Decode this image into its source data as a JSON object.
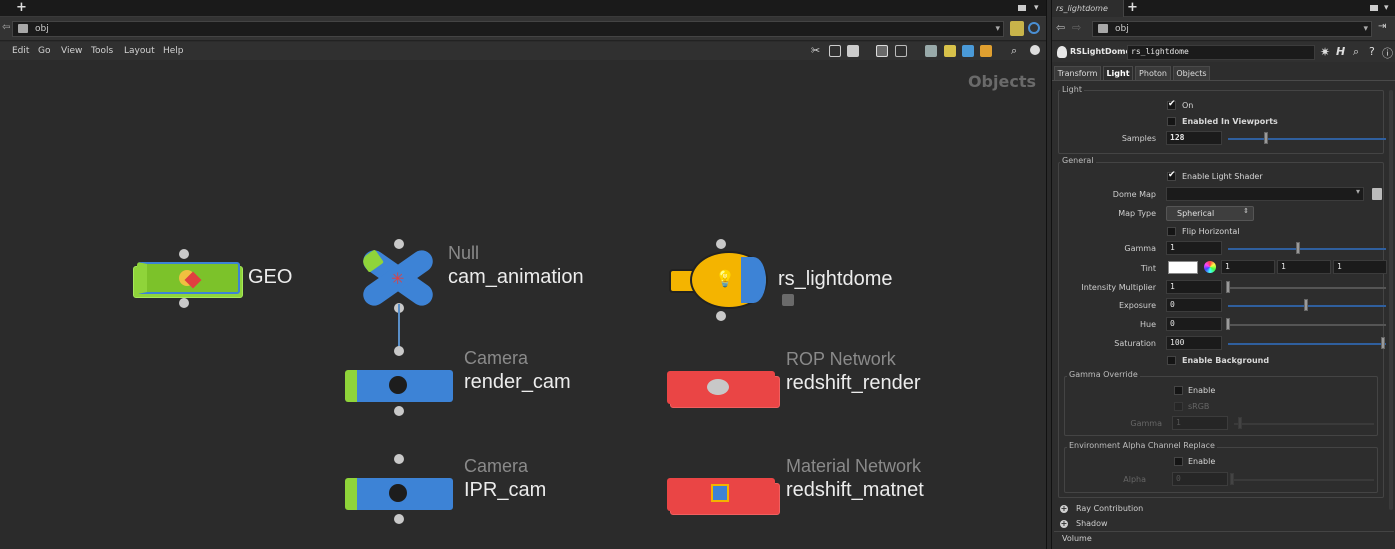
{
  "left_pane": {
    "path": "obj",
    "menu": [
      "Edit",
      "Go",
      "View",
      "Tools",
      "Layout",
      "Help"
    ],
    "network_title": "Objects"
  },
  "nodes": {
    "geo": {
      "name": "GEO",
      "type": ""
    },
    "null": {
      "name": "cam_animation",
      "type": "Null"
    },
    "light": {
      "name": "rs_lightdome",
      "type": ""
    },
    "render_cam": {
      "name": "render_cam",
      "type": "Camera"
    },
    "rop": {
      "name": "redshift_render",
      "type": "ROP Network"
    },
    "ipr_cam": {
      "name": "IPR_cam",
      "type": "Camera"
    },
    "matnet": {
      "name": "redshift_matnet",
      "type": "Material Network"
    }
  },
  "right_pane": {
    "tab_title": "rs_lightdome",
    "path": "obj",
    "node_type": "RSLightDome",
    "node_name": "rs_lightdome",
    "tabs": [
      "Transform",
      "Light",
      "Photon",
      "Objects"
    ],
    "active_tab": "Light",
    "light_group": {
      "title": "Light",
      "on_label": "On",
      "on_checked": true,
      "viewports_label": "Enabled In Viewports",
      "viewports_checked": false,
      "samples_label": "Samples",
      "samples_value": "128",
      "samples_fraction": 0.25
    },
    "general_group": {
      "title": "General",
      "enable_shader_label": "Enable Light Shader",
      "enable_shader_checked": true,
      "dome_map_label": "Dome Map",
      "dome_map_value": "",
      "map_type_label": "Map Type",
      "map_type_value": "Spherical",
      "flip_label": "Flip Horizontal",
      "flip_checked": false,
      "gamma_label": "Gamma",
      "gamma_value": "1",
      "gamma_fraction": 0.45,
      "tint_label": "Tint",
      "tint_values": [
        "1",
        "1",
        "1"
      ],
      "intensity_label": "Intensity Multiplier",
      "intensity_value": "1",
      "intensity_fraction": 0.0,
      "exposure_label": "Exposure",
      "exposure_value": "0",
      "exposure_fraction": 0.5,
      "hue_label": "Hue",
      "hue_value": "0",
      "hue_fraction": 0.0,
      "saturation_label": "Saturation",
      "saturation_value": "100",
      "saturation_fraction": 1.0,
      "enable_bg_label": "Enable Background",
      "enable_bg_checked": false
    },
    "gamma_override": {
      "title": "Gamma Override",
      "enable_label": "Enable",
      "srgb_label": "sRGB",
      "gamma_label": "Gamma",
      "gamma_value": "1"
    },
    "env_alpha": {
      "title": "Environment Alpha Channel Replace",
      "enable_label": "Enable",
      "alpha_label": "Alpha",
      "alpha_value": "0"
    },
    "folders": [
      "Ray Contribution",
      "Shadow",
      "Volume"
    ]
  },
  "colors": {
    "green_node": "#8fd43a",
    "blue_node": "#3d83d6",
    "red_node": "#ea4545",
    "light_yellow": "#f4b400"
  }
}
